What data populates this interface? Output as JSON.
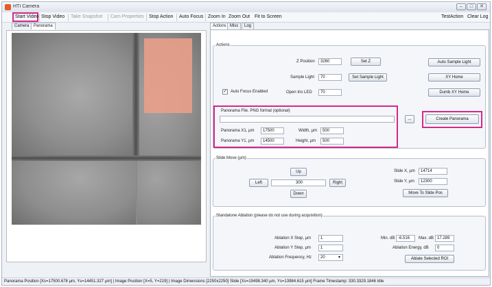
{
  "window": {
    "title": "HTI Camera",
    "controls": [
      "–",
      "□",
      "✕"
    ]
  },
  "menu": {
    "start_video": "Start Video",
    "stop_video": "Stop Video",
    "take_snapshot": "Take Snapshot",
    "cam_properties": "Cam Properties",
    "stop_action": "Stop Action",
    "auto_focus": "Auto Focus",
    "zoom_in": "Zoom In",
    "zoom_out": "Zoom Out",
    "fit_to_screen": "Fit to Screen",
    "test_action": "TestAction",
    "clear_log": "Clear Log"
  },
  "left_tabs": [
    "Camera",
    "Panorama"
  ],
  "right_tabs": [
    "Actions",
    "Misc",
    "Log"
  ],
  "actions": {
    "group_title": "Actions",
    "z_position_label": "Z Position",
    "z_position_value": "3260",
    "set_z": "Set Z",
    "auto_sample_light": "Auto Sample Light",
    "sample_light_label": "Sample Light",
    "sample_light_value": "70",
    "set_sample_light": "Set Sample Light",
    "xy_home": "XY Home",
    "auto_focus_enabled": "Auto Focus Enabled",
    "open_iris_label": "Open Iris LED",
    "open_iris_value": "70",
    "dumb_xy_home": "Dumb XY Home"
  },
  "panorama": {
    "file_label": "Panorama File. PNG format (optional)",
    "file_value": "",
    "browse": "...",
    "create": "Create Panorama",
    "x1_label": "Panorama X1, µm",
    "x1_value": "17500",
    "y1_label": "Panorama Y1, µm",
    "y1_value": "14500",
    "width_label": "Width, µm",
    "width_value": "500",
    "height_label": "Height, µm",
    "height_value": "500"
  },
  "slide_move": {
    "title": "Slide Move (µm)",
    "up": "Up",
    "left": "Left",
    "step_value": "300",
    "right": "Right",
    "down": "Down",
    "slide_x_label": "Slide X, µm",
    "slide_x_value": "14714",
    "slide_y_label": "Slide Y, µm",
    "slide_y_value": "12300",
    "move_to_slide": "Move To Slide Pos"
  },
  "ablation": {
    "title": "Standalone Ablation (please do not use during acquisition)",
    "x_step_label": "Ablation X Step, µm",
    "x_step_value": "1",
    "y_step_label": "Ablation Y Step, µm",
    "y_step_value": "1",
    "freq_label": "Ablation Frequency, Hz",
    "freq_value": "20",
    "min_db_label": "Min. dB",
    "min_db_value": "-6.516",
    "max_db_label": "Max. dB",
    "max_db_value": "17.289",
    "energy_label": "Ablation Energy, dB",
    "energy_value": "0",
    "ablate_selected": "Ablate Selected ROI"
  },
  "status": "Panorama Position [Xs=17500.678 µm, Ys=14451.327 µm] | Image Position [X=5, Y=219] | Image Dimensions [2250x2250]   Slide [Xs=19498.340 µm, Ys=13984.615 µm]   Frame Timestamp: 330.3329.1846  Idle",
  "colors": {
    "highlight": "#d6268a",
    "roi": "#e9a08a"
  }
}
